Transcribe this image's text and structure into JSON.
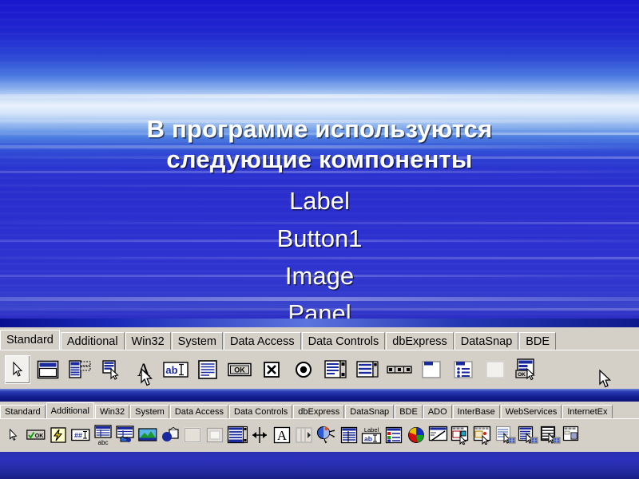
{
  "slide": {
    "title": "В программе используются следующие компоненты",
    "title_line1": "В программе используются",
    "title_line2": "следующие компоненты",
    "components": [
      "Label",
      "Button1",
      "Image",
      "Panel"
    ],
    "background_top_color": "#1a18cc",
    "background_horizon_color": "#e9f1fc",
    "background_bottom_color": "#2326bb",
    "text_color": "#ffffff"
  },
  "palette_standard": {
    "name": "Component Palette",
    "active_tab": "Standard",
    "tabs": [
      {
        "label": "Standard",
        "active": true
      },
      {
        "label": "Additional",
        "active": false
      },
      {
        "label": "Win32",
        "active": false
      },
      {
        "label": "System",
        "active": false
      },
      {
        "label": "Data Access",
        "active": false
      },
      {
        "label": "Data Controls",
        "active": false
      },
      {
        "label": "dbExpress",
        "active": false
      },
      {
        "label": "DataSnap",
        "active": false
      },
      {
        "label": "BDE",
        "active": false
      }
    ],
    "tools": [
      {
        "icon": "pointer-arrow-icon",
        "label": "Pointer",
        "selected": true
      },
      {
        "icon": "frames-window-icon",
        "label": "Frames"
      },
      {
        "icon": "main-menu-icon",
        "label": "MainMenu"
      },
      {
        "icon": "popup-menu-icon",
        "label": "PopupMenu"
      },
      {
        "icon": "label-A-icon",
        "label": "Label"
      },
      {
        "icon": "edit-abI-icon",
        "label": "Edit"
      },
      {
        "icon": "memo-lines-icon",
        "label": "Memo"
      },
      {
        "icon": "button-ok-icon",
        "label": "Button"
      },
      {
        "icon": "checkbox-x-icon",
        "label": "CheckBox"
      },
      {
        "icon": "radiobutton-dot-icon",
        "label": "RadioButton"
      },
      {
        "icon": "listbox-icon",
        "label": "ListBox"
      },
      {
        "icon": "combobox-icon",
        "label": "ComboBox"
      },
      {
        "icon": "scrollbar-icon",
        "label": "ScrollBar"
      },
      {
        "icon": "groupbox-icon",
        "label": "GroupBox"
      },
      {
        "icon": "radiogroup-icon",
        "label": "RadioGroup"
      },
      {
        "icon": "panel-icon",
        "label": "Panel"
      },
      {
        "icon": "actionlist-icon",
        "label": "ActionList"
      }
    ]
  },
  "palette_additional": {
    "name": "Component Palette",
    "active_tab": "Additional",
    "tabs": [
      {
        "label": "Standard",
        "active": false
      },
      {
        "label": "Additional",
        "active": true
      },
      {
        "label": "Win32",
        "active": false
      },
      {
        "label": "System",
        "active": false
      },
      {
        "label": "Data Access",
        "active": false
      },
      {
        "label": "Data Controls",
        "active": false
      },
      {
        "label": "dbExpress",
        "active": false
      },
      {
        "label": "DataSnap",
        "active": false
      },
      {
        "label": "BDE",
        "active": false
      },
      {
        "label": "ADO",
        "active": false
      },
      {
        "label": "InterBase",
        "active": false
      },
      {
        "label": "WebServices",
        "active": false
      },
      {
        "label": "InternetEx",
        "active": false
      }
    ],
    "tools": [
      {
        "icon": "pointer-arrow-icon",
        "label": "Pointer",
        "selected": true
      },
      {
        "icon": "bitbtn-ok-icon",
        "label": "BitBtn"
      },
      {
        "icon": "speedbutton-lightning-icon",
        "label": "SpeedButton"
      },
      {
        "icon": "maskedit-hash-icon",
        "label": "MaskEdit"
      },
      {
        "icon": "stringgrid-abc-icon",
        "label": "StringGrid"
      },
      {
        "icon": "drawgrid-icon",
        "label": "DrawGrid"
      },
      {
        "icon": "image-picture-icon",
        "label": "Image"
      },
      {
        "icon": "shape-icon",
        "label": "Shape"
      },
      {
        "icon": "bevel-icon",
        "label": "Bevel"
      },
      {
        "icon": "scrollbox-icon",
        "label": "ScrollBox"
      },
      {
        "icon": "checklistbox-icon",
        "label": "CheckListBox"
      },
      {
        "icon": "splitter-icon",
        "label": "Splitter"
      },
      {
        "icon": "staticText-A-icon",
        "label": "StaticText"
      },
      {
        "icon": "controlbar-icon",
        "label": "ControlBar"
      },
      {
        "icon": "applicationevents-icon",
        "label": "ApplicationEvents"
      },
      {
        "icon": "valuelisteditor-icon",
        "label": "ValueListEditor"
      },
      {
        "icon": "labelededit-icon",
        "label": "LabeledEdit"
      },
      {
        "icon": "colorbox-icon",
        "label": "ColorBox"
      },
      {
        "icon": "chart-pie-icon",
        "label": "Chart"
      },
      {
        "icon": "actionmanager-icon",
        "label": "ActionManager"
      },
      {
        "icon": "actionmainmenubar-icon",
        "label": "ActionMainMenuBar"
      },
      {
        "icon": "actiontoolbar-icon",
        "label": "ActionToolBar"
      },
      {
        "icon": "customizedlg-icon",
        "label": "CustomizeDlg"
      },
      {
        "icon": "xpcolormap-icon",
        "label": "XPColorMap"
      },
      {
        "icon": "standardcolormap-icon",
        "label": "StandardColorMap"
      },
      {
        "icon": "twilightcolormap-icon",
        "label": "TwilightColorMap"
      }
    ]
  }
}
